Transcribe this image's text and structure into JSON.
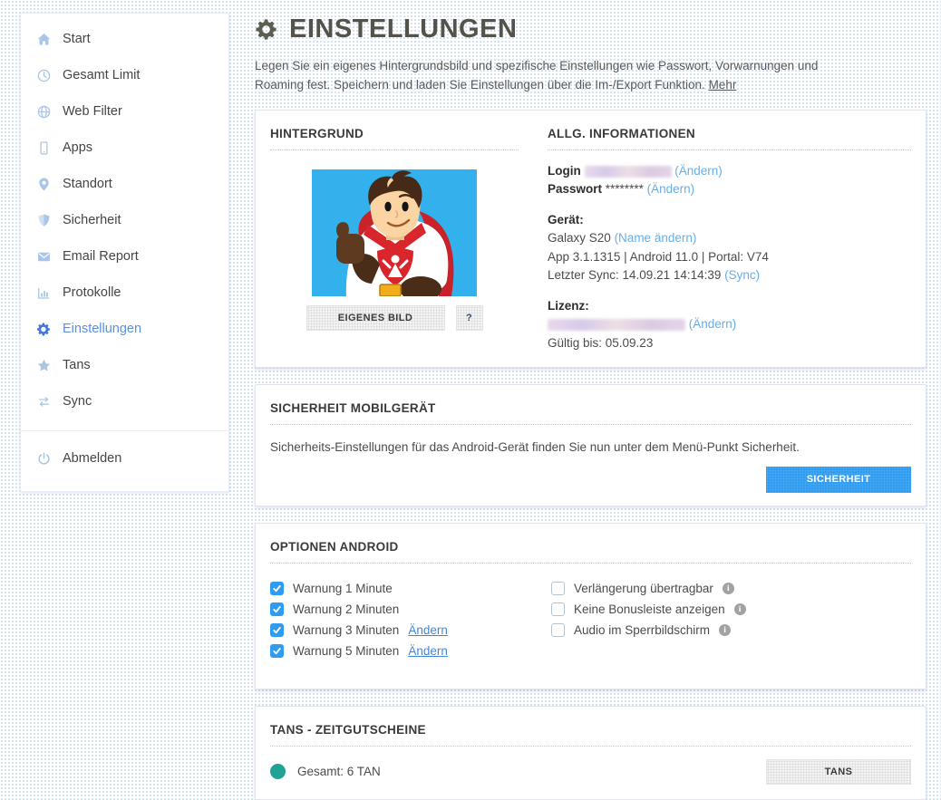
{
  "header": {
    "title": "EINSTELLUNGEN",
    "description": "Legen Sie ein eigenes Hintergrundsbild und spezifische Einstellungen wie Passwort, Vorwarnungen und Roaming fest. Speichern und laden Sie Einstellungen über die Im-/Export Funktion.",
    "more_link": "Mehr"
  },
  "sidebar": {
    "items": [
      {
        "label": "Start",
        "icon": "home-icon",
        "active": false
      },
      {
        "label": "Gesamt Limit",
        "icon": "clock-icon",
        "active": false
      },
      {
        "label": "Web Filter",
        "icon": "globe-icon",
        "active": false
      },
      {
        "label": "Apps",
        "icon": "smartphone-icon",
        "active": false
      },
      {
        "label": "Standort",
        "icon": "location-pin-icon",
        "active": false
      },
      {
        "label": "Sicherheit",
        "icon": "shield-icon",
        "active": false
      },
      {
        "label": "Email Report",
        "icon": "envelope-icon",
        "active": false
      },
      {
        "label": "Protokolle",
        "icon": "bar-chart-icon",
        "active": false
      },
      {
        "label": "Einstellungen",
        "icon": "gear-icon",
        "active": true
      },
      {
        "label": "Tans",
        "icon": "star-icon",
        "active": false
      },
      {
        "label": "Sync",
        "icon": "sync-arrows-icon",
        "active": false
      }
    ],
    "logout_label": "Abmelden"
  },
  "hintergrund": {
    "title": "HINTERGRUND",
    "own_image_button": "EIGENES BILD",
    "help_button": "?"
  },
  "allg": {
    "title": "ALLG. INFORMATIONEN",
    "login_label": "Login",
    "login_change_link": "(Ändern)",
    "passwort_label": "Passwort",
    "passwort_value": "********",
    "passwort_change_link": "(Ändern)",
    "geraet_label": "Gerät:",
    "geraet_name": "Galaxy S20",
    "geraet_rename_link": "(Name ändern)",
    "app_info": "App 3.1.1315  |  Android 11.0  |  Portal: V74",
    "last_sync": "Letzter Sync: 14.09.21 14:14:39",
    "sync_link": "(Sync)",
    "lizenz_label": "Lizenz:",
    "lizenz_change_link": "(Ändern)",
    "gueltig_bis": "Gültig bis: 05.09.23"
  },
  "sicherheit": {
    "title": "SICHERHEIT MOBILGERÄT",
    "text": "Sicherheits-Einstellungen für das Android-Gerät finden Sie nun unter dem Menü-Punkt Sicherheit.",
    "button": "SICHERHEIT"
  },
  "optionen": {
    "title": "OPTIONEN ANDROID",
    "left": [
      {
        "label": "Warnung 1 Minute",
        "checked": true
      },
      {
        "label": "Warnung 2 Minuten",
        "checked": true
      },
      {
        "label": "Warnung 3 Minuten",
        "checked": true,
        "link": "Ändern"
      },
      {
        "label": "Warnung 5 Minuten",
        "checked": true,
        "link": "Ändern"
      }
    ],
    "right": [
      {
        "label": "Verlängerung übertragbar",
        "checked": false,
        "info": "i"
      },
      {
        "label": "Keine Bonusleiste anzeigen",
        "checked": false,
        "info": "i"
      },
      {
        "label": "Audio im Sperrbildschirm",
        "checked": false,
        "info": "i"
      }
    ]
  },
  "tans": {
    "title": "TANS - ZEITGUTSCHEINE",
    "summary": "Gesamt: 6 TAN",
    "button": "TANS"
  },
  "colors": {
    "accent_blue": "#2e9cf0",
    "link_blue": "#68aee8",
    "active_nav_blue": "#5b8fe0",
    "tan_dot_teal": "#21a295",
    "title_gray": "#53534a",
    "hero_background_blue": "#33b1ec",
    "hero_cape_red": "#d8262c"
  }
}
